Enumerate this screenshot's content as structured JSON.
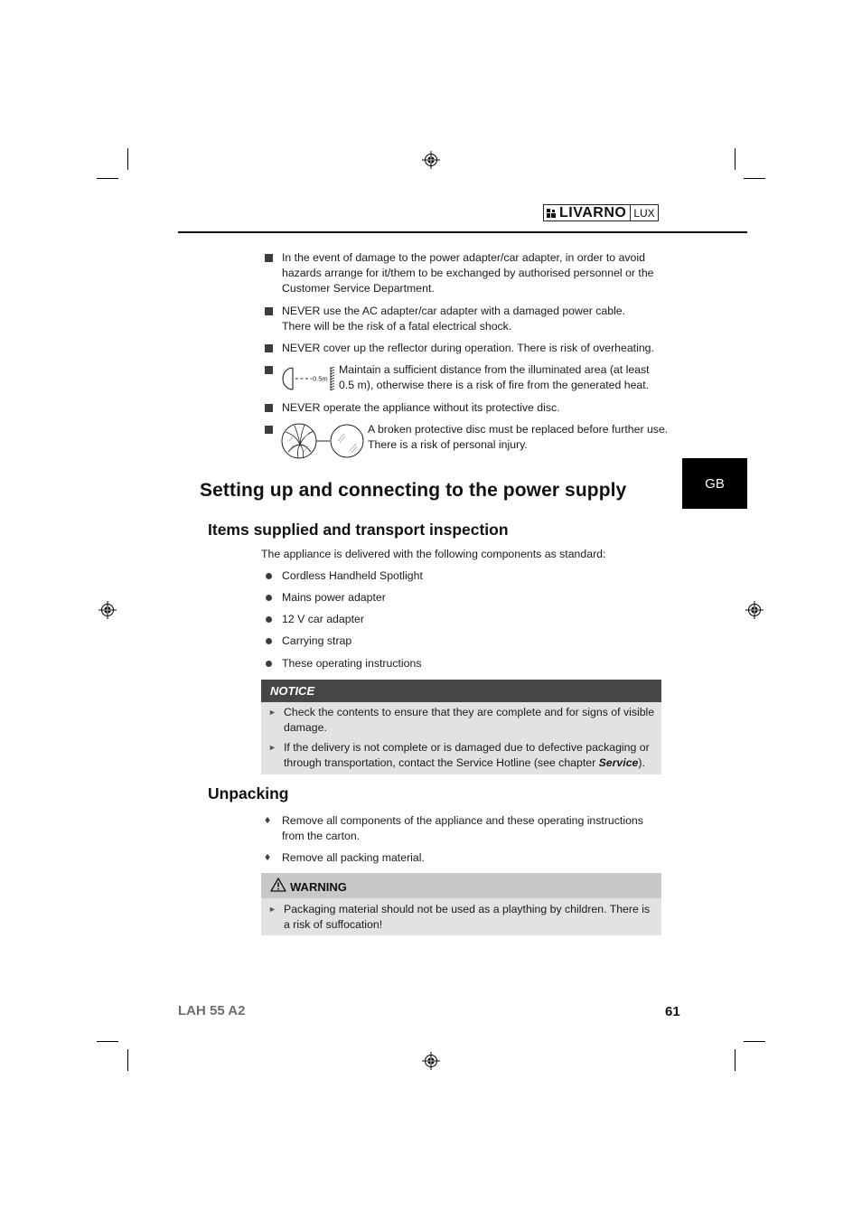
{
  "header": {
    "brand": "LIVARNO",
    "brand_suffix": "LUX"
  },
  "language_tab": "GB",
  "safety_items": [
    {
      "icon": "none",
      "text_lines": [
        "In the event of damage to the power adapter/car adapter, in order to avoid",
        "hazards arrange for it/them to be exchanged by authorised personnel or the",
        "Customer Service Department."
      ]
    },
    {
      "icon": "none",
      "text_lines": [
        "NEVER use the AC adapter/car adapter with a damaged power cable.",
        "There will be the risk of a fatal electrical shock."
      ]
    },
    {
      "icon": "none",
      "text_lines": [
        "NEVER cover up the reflector during operation. There is risk of overheating."
      ]
    },
    {
      "icon": "distance-0.5m-icon",
      "icon_label": "0.5m",
      "text_lines": [
        "Maintain a sufficient distance from the illuminated area (at least",
        "0.5 m), otherwise there is a risk of fire from the generated heat."
      ]
    },
    {
      "icon": "none",
      "text_lines": [
        "NEVER operate the appliance without its protective disc."
      ]
    },
    {
      "icon": "broken-disc-icon",
      "text_lines": [
        "A broken protective disc must be replaced before further use.",
        "There is a risk of personal injury."
      ]
    }
  ],
  "section": {
    "title": "Setting up and connecting to the power supply"
  },
  "items_supplied": {
    "heading": "Items supplied and transport inspection",
    "intro": "The appliance is delivered with the following components as standard:",
    "items": [
      "Cordless Handheld Spotlight",
      "Mains power adapter",
      "12 V car adapter",
      "Carrying strap",
      "These operating instructions"
    ]
  },
  "notice": {
    "label": "NOTICE",
    "items": [
      {
        "lines": [
          "Check the contents to ensure that they are complete and for signs of visible",
          "damage."
        ]
      },
      {
        "lines": [
          "If the delivery is not complete or is damaged due to defective packaging or",
          "through transportation, contact the Service Hotline (see chapter "
        ],
        "bold": "Service",
        "suffix": ")."
      }
    ]
  },
  "unpacking": {
    "heading": "Unpacking",
    "items": [
      {
        "lines": [
          "Remove all components of the appliance and these operating instructions",
          "from the carton."
        ]
      },
      {
        "lines": [
          "Remove all packing material."
        ]
      }
    ]
  },
  "warning": {
    "label": "WARNING",
    "icon": "warning-triangle-icon",
    "lines": [
      "Packaging material should not be used as a plaything by children. There is",
      "a risk of suffocation!"
    ]
  },
  "footer": {
    "model": "LAH 55 A2",
    "page_number": "61"
  }
}
